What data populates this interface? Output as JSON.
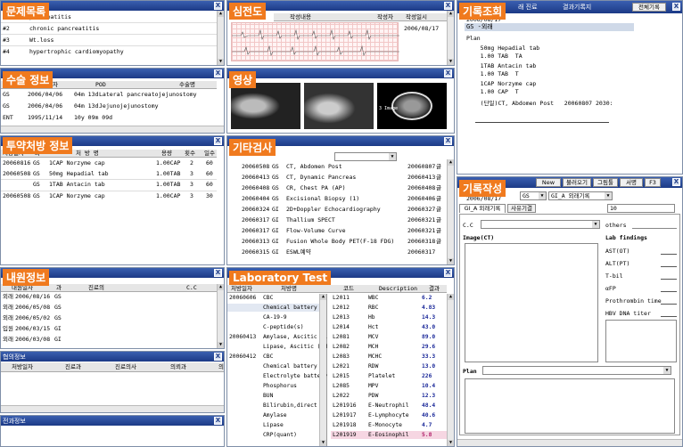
{
  "problem_list": {
    "badge": "문제목록",
    "rows": [
      {
        "no": "",
        "text": "pancreatitis"
      },
      {
        "no": "#2",
        "text": "chronic pancreatitis"
      },
      {
        "no": "#3",
        "text": "Wt.loss"
      },
      {
        "no": "#4",
        "text": "hypertrophic cardiomyopathy"
      }
    ]
  },
  "ecg": {
    "badge": "심전도",
    "headers": [
      "작성내용",
      "작성자",
      "작성일시"
    ],
    "date": "2006/08/17"
  },
  "record_view": {
    "badge": "기록조회",
    "tabs": [
      "래 진료",
      "결과기록지"
    ],
    "all_button": "전체기록",
    "close": "X",
    "date": "2006/08/17",
    "selected": "GS  -외래",
    "lines": [
      "Plan",
      "    50mg Hepadial tab",
      "    1.00 TAB  TA",
      "    1TAB Antacin tab",
      "    1.00 TAB  T",
      "    1CAP Norzyme cap",
      "    1.00 CAP  T",
      "    (단일)CT, Abdomen Post   20060807 2030:"
    ]
  },
  "surgery": {
    "badge": "수술 정보",
    "headers": [
      "일자",
      "POD",
      "수술명"
    ],
    "rows": [
      {
        "dept": "GS",
        "date": "2006/04/06",
        "pod": "04m 13d",
        "name": "Lateral pancreatojejunostomy"
      },
      {
        "dept": "GS",
        "date": "2006/04/06",
        "pod": "04m 13d",
        "name": "Jejunojejunostomy"
      },
      {
        "dept": "ENT",
        "date": "1995/11/14",
        "pod": "10y 09m 09d",
        "name": ""
      }
    ]
  },
  "image": {
    "badge": "영상",
    "thumbs": [
      "chest-xray-1",
      "chest-xray-2",
      "ct-image"
    ],
    "ct_label": "3 Image"
  },
  "prescription": {
    "badge": "투약처방 정보",
    "headers": [
      "처방일자",
      "과",
      "처 방 명",
      "용량",
      "횟수",
      "일수"
    ],
    "rows": [
      {
        "date": "20060816",
        "dept": "GS",
        "name": "1CAP Norzyme cap",
        "dose": "1.00CAP",
        "freq": "2",
        "days": "60"
      },
      {
        "date": "20060508",
        "dept": "GS",
        "name": "50mg Hepadial tab",
        "dose": "1.00TAB",
        "freq": "3",
        "days": "60"
      },
      {
        "date": "",
        "dept": "GS",
        "name": "1TAB Antacin tab",
        "dose": "1.00TAB",
        "freq": "3",
        "days": "60"
      },
      {
        "date": "20060508",
        "dept": "GS",
        "name": "1CAP Norzyme cap",
        "dose": "1.00CAP",
        "freq": "3",
        "days": "30"
      }
    ]
  },
  "other_tests": {
    "badge": "기타검사",
    "rows": [
      {
        "date": "20060508",
        "dept": "GS",
        "name": "CT, Abdomen Post",
        "date2": "20060807",
        "flag": "글"
      },
      {
        "date": "20060413",
        "dept": "GS",
        "name": "CT, Dynamic Pancreas",
        "date2": "20060413",
        "flag": "글"
      },
      {
        "date": "20060408",
        "dept": "GS",
        "name": "CR, Chest PA (AP)",
        "date2": "20060408",
        "flag": "글"
      },
      {
        "date": "20060404",
        "dept": "GS",
        "name": "Excisional Biopsy (1)",
        "date2": "20060406",
        "flag": "글"
      },
      {
        "date": "20060324",
        "dept": "GI",
        "name": "2D+Doppler Echocardiography",
        "date2": "20060327",
        "flag": "글"
      },
      {
        "date": "20060317",
        "dept": "GI",
        "name": "Thallium SPECT",
        "date2": "20060321",
        "flag": "글"
      },
      {
        "date": "20060317",
        "dept": "GI",
        "name": "Flow-Volume Curve",
        "date2": "20060321",
        "flag": "글"
      },
      {
        "date": "20060313",
        "dept": "GI",
        "name": "Fusion Whole Body  PET(F-18 FDG)",
        "date2": "20060318",
        "flag": "글"
      },
      {
        "date": "20060315",
        "dept": "GI",
        "name": "ESWL예약",
        "date2": "20060317",
        "flag": ""
      }
    ]
  },
  "visits": {
    "badge": "내원정보",
    "headers": [
      "내원일자",
      "과",
      "진료의",
      "C.C"
    ],
    "rows": [
      {
        "type": "외래",
        "date": "2006/08/16",
        "dept": "GS"
      },
      {
        "type": "외래",
        "date": "2006/05/08",
        "dept": "GS"
      },
      {
        "type": "외래",
        "date": "2006/05/02",
        "dept": "GS"
      },
      {
        "type": "입원",
        "date": "2006/03/15",
        "dept": "GI"
      },
      {
        "type": "외래",
        "date": "2006/03/08",
        "dept": "GI"
      }
    ]
  },
  "consult": {
    "title": "협의정보",
    "headers": [
      "처방일자",
      "진료과",
      "진료의사",
      "의뢰과",
      "의"
    ]
  },
  "transfer": {
    "title": "전과정보"
  },
  "lab": {
    "badge": "Laboratory Test",
    "headers": [
      "처방일자",
      "처방명",
      "코드",
      "Description",
      "결과"
    ],
    "left_rows": [
      {
        "date": "20060606",
        "name": "CBC"
      },
      {
        "date": "",
        "name": "Chemical battery"
      },
      {
        "date": "",
        "name": "CA-19-9"
      },
      {
        "date": "",
        "name": "C-peptide(s)"
      },
      {
        "date": "20060413",
        "name": "Amylase, Ascitic fl"
      },
      {
        "date": "",
        "name": "Lipase, Ascitic (EM"
      },
      {
        "date": "20060412",
        "name": "CBC"
      },
      {
        "date": "",
        "name": "Chemical battery"
      },
      {
        "date": "",
        "name": "Electrolyte battery"
      },
      {
        "date": "",
        "name": "Phosphorus"
      },
      {
        "date": "",
        "name": "BUN"
      },
      {
        "date": "",
        "name": "Bilirubin,direct"
      },
      {
        "date": "",
        "name": "Amylase"
      },
      {
        "date": "",
        "name": "Lipase"
      },
      {
        "date": "",
        "name": "CRP(quant)"
      }
    ],
    "right_rows": [
      {
        "code": "L2011",
        "desc": "WBC",
        "value": "6.2"
      },
      {
        "code": "L2012",
        "desc": "RBC",
        "value": "4.83"
      },
      {
        "code": "L2013",
        "desc": "Hb",
        "value": "14.3"
      },
      {
        "code": "L2014",
        "desc": "Hct",
        "value": "43.0"
      },
      {
        "code": "L2081",
        "desc": "MCV",
        "value": "89.0"
      },
      {
        "code": "L2082",
        "desc": "MCH",
        "value": "29.6"
      },
      {
        "code": "L2083",
        "desc": "MCHC",
        "value": "33.3"
      },
      {
        "code": "L2021",
        "desc": "RDW",
        "value": "13.0"
      },
      {
        "code": "L2015",
        "desc": "Platelet",
        "value": "226"
      },
      {
        "code": "L2085",
        "desc": "MPV",
        "value": "10.4"
      },
      {
        "code": "L2022",
        "desc": "PDW",
        "value": "12.3"
      },
      {
        "code": "L201916",
        "desc": "E-Neutrophil",
        "value": "48.4"
      },
      {
        "code": "L201917",
        "desc": "E-Lymphocyte",
        "value": "40.6"
      },
      {
        "code": "L201918",
        "desc": "E-Monocyte",
        "value": "4.7"
      },
      {
        "code": "L201919",
        "desc": "E-Eosinophil",
        "value": "5.8"
      }
    ]
  },
  "record_write": {
    "badge": "기록작성",
    "buttons": [
      "New",
      "불러오기",
      "그림툴",
      "서명",
      "F3"
    ],
    "date": "2006/08/17",
    "dept": "GS",
    "form": "GI_A 외래기록",
    "tab1": "GI_A 외래기록",
    "tab2": "사유기결",
    "field_value": "10",
    "cc_label": "C.C",
    "others_label": "others",
    "image_label": "Image(CT)",
    "lab_label": "Lab findings",
    "lab_items": [
      "AST(OT)",
      "ALT(PT)",
      "T-bil",
      "αFP",
      "Prothrombin time",
      "HBV DNA titer"
    ],
    "plan_label": "Plan"
  }
}
